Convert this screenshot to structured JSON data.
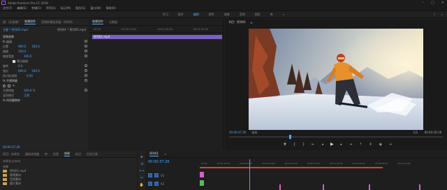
{
  "window": {
    "title": "Adobe Premiere Pro CC 2018"
  },
  "menu": [
    "文件(F)",
    "编辑(E)",
    "剪辑(C)",
    "序列(S)",
    "标记(M)",
    "图形(G)",
    "窗口(W)",
    "帮助(H)"
  ],
  "workspaces": [
    "学习",
    "组件",
    "编辑",
    "颜色",
    "效果",
    "音频",
    "图形",
    "库"
  ],
  "effect_controls": {
    "tabs": [
      "源：(无剪辑)",
      "效果控件",
      "音频剪辑混合器：序列01"
    ],
    "source": "主要 * 序列01.mp4",
    "clip": "序列01 * 序列01.mp4",
    "rows": [
      {
        "label": "视频效果",
        "section": true
      },
      {
        "label": "fx 运动",
        "section": true
      },
      {
        "label": "位置",
        "v1": "960.0",
        "v2": "540.0"
      },
      {
        "label": "缩放",
        "v1": "100.0"
      },
      {
        "label": "缩放宽度",
        "v1": "100.0"
      },
      {
        "label": "等比缩放",
        "check": true
      },
      {
        "label": "旋转",
        "v1": "0.0"
      },
      {
        "label": "锚点",
        "v1": "960.0",
        "v2": "540.0"
      },
      {
        "label": "防闪烁滤镜",
        "v1": "0.00"
      },
      {
        "label": "fx 不透明度",
        "section": true
      },
      {
        "label": "shapes",
        "shapes": true
      },
      {
        "label": "不透明度",
        "v1": "100.0 %"
      },
      {
        "label": "混合模式",
        "v1": "正常"
      },
      {
        "label": "fx 时间重映射",
        "section": true
      }
    ],
    "timecode": "00:00:37:26"
  },
  "mini_timeline": {
    "tabs": [
      "效果控件",
      "元数据"
    ],
    "ruler": [
      "00:00",
      "00:00:30:00",
      "00:01:00:00",
      "00:01:30:00"
    ],
    "clip_label": "序列01.mp4"
  },
  "program_monitor": {
    "title": "节目：序列01",
    "timecode": "00:00:37:26",
    "fit": "适合",
    "ratio": "1/2",
    "duration": "00:02:18:18"
  },
  "project": {
    "tabs": [
      "项目：未命名",
      "媒体浏览器",
      "库",
      "信息",
      "效果",
      "标记",
      "历史记录"
    ],
    "path": "未命名.prproj",
    "items": [
      "名称",
      "序列01.mp4",
      "视频素材",
      "音频素材",
      "图片素材",
      "调整图层"
    ]
  },
  "timeline": {
    "tabs": [
      "序列01"
    ],
    "timecode": "00:00:37:26",
    "ruler": [
      "00:00",
      "00:00:15:00",
      "00:00:30:00",
      "00:00:45:00",
      "00:01:00:00",
      "00:01:15:00",
      "00:01:30:00",
      "00:01:45:00",
      "00:02:00:00",
      "00:02:15:00"
    ],
    "tracks": [
      "V1",
      "A1"
    ]
  },
  "colors": {
    "accent": "#4aa8ff",
    "clip_video": "#8a6fd6",
    "clip_audio": "#5cb85c",
    "clip_pink": "#d55fd1"
  }
}
